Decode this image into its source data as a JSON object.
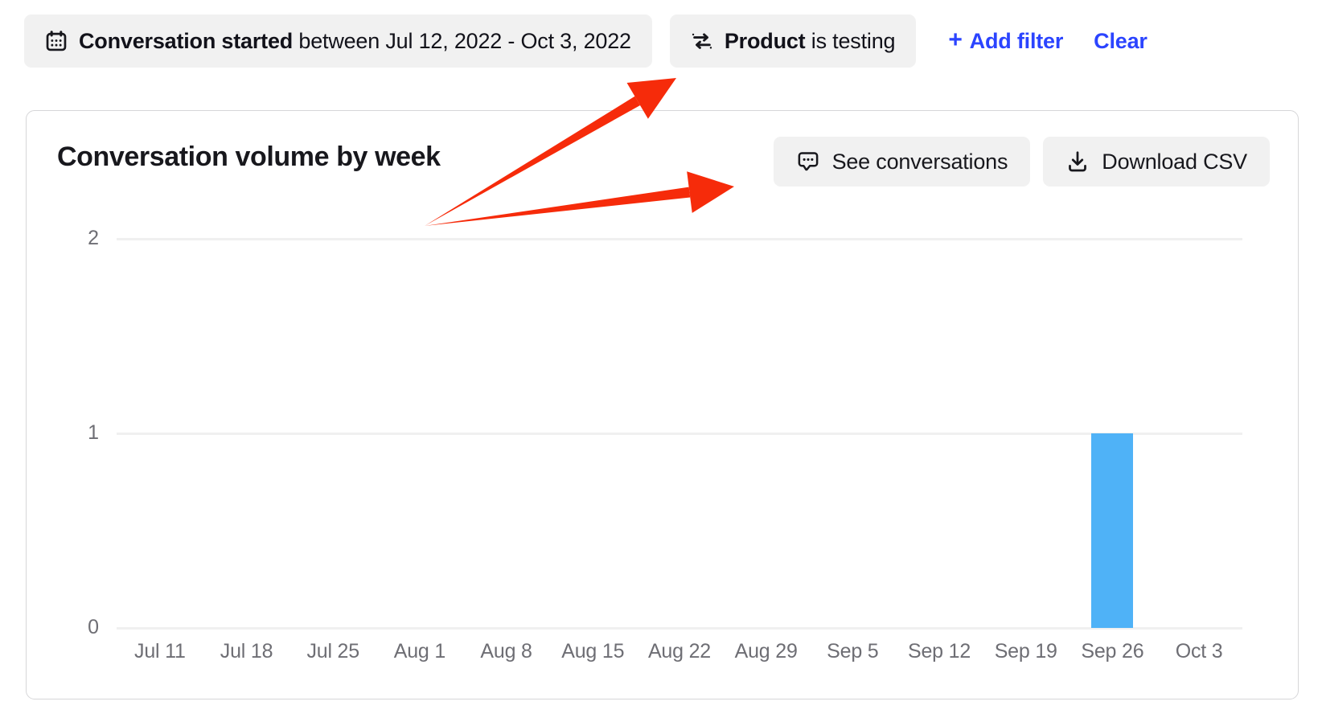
{
  "filter_bar": {
    "filters": [
      {
        "icon": "calendar-icon",
        "field": "Conversation started",
        "operator_and_value": " between Jul 12, 2022 - Oct 3, 2022"
      },
      {
        "icon": "transfer-arrows-icon",
        "field": "Product",
        "operator_and_value": " is testing"
      }
    ],
    "add_filter_label": "Add filter",
    "add_filter_plus": "+",
    "clear_label": "Clear",
    "link_color": "#2b44ff"
  },
  "card": {
    "title": "Conversation volume by week",
    "actions": [
      {
        "icon": "speech-bubble-icon",
        "label": "See conversations"
      },
      {
        "icon": "download-icon",
        "label": "Download CSV"
      }
    ]
  },
  "chart_data": {
    "type": "bar",
    "title": "Conversation volume by week",
    "xlabel": "",
    "ylabel": "",
    "categories": [
      "Jul 11",
      "Jul 18",
      "Jul 25",
      "Aug 1",
      "Aug 8",
      "Aug 15",
      "Aug 22",
      "Aug 29",
      "Sep 5",
      "Sep 12",
      "Sep 19",
      "Sep 26",
      "Oct 3"
    ],
    "values": [
      0,
      0,
      0,
      0,
      0,
      0,
      0,
      0,
      0,
      0,
      0,
      1,
      0
    ],
    "ylim": [
      0,
      2
    ],
    "yticks": [
      "0",
      "1",
      "2"
    ],
    "ytick_values": [
      0,
      1,
      2
    ],
    "grid": true,
    "legend": false,
    "bar_color": "#4fb2f7",
    "gridline_color": "#f0f0f0"
  },
  "annotations": {
    "arrow_color": "#f62b0a",
    "arrows": [
      {
        "name": "arrow-to-add-filter",
        "from": [
          528,
          281
        ],
        "to": [
          841,
          97
        ]
      },
      {
        "name": "arrow-to-see-conversations",
        "from": [
          528,
          281
        ],
        "to": [
          913,
          232
        ]
      }
    ]
  }
}
